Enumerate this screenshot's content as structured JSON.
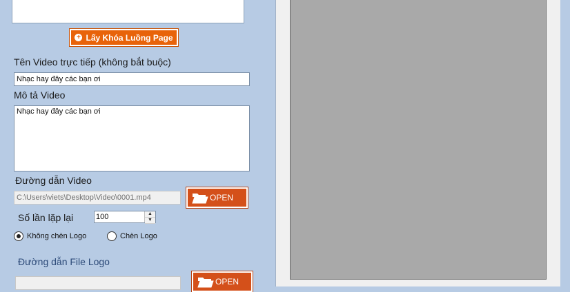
{
  "page_key_button": {
    "label": "Lấy Khóa Luồng Page",
    "icon": "plus-circle-icon"
  },
  "live_video_name": {
    "label": "Tên Video trực tiếp (không bắt buộc)",
    "value": "Nhạc hay đây các bạn ơi"
  },
  "video_description": {
    "label": "Mô tả Video",
    "value": "Nhạc hay đây các bạn ơi"
  },
  "video_path": {
    "label": "Đường dẫn Video",
    "value": "C:\\Users\\viets\\Desktop\\Video\\0001.mp4",
    "open_label": "OPEN"
  },
  "repeat_count": {
    "label": "Số lần lặp lại",
    "value": "100"
  },
  "logo_options": {
    "no_logo": "Không chèn Logo",
    "insert_logo": "Chèn Logo",
    "selected": "no_logo"
  },
  "logo_path": {
    "label": "Đường dẫn File Logo",
    "value": "",
    "open_label": "OPEN"
  },
  "colors": {
    "background": "#b7cbe4",
    "accent": "#e8630a",
    "open_button": "#d4501a",
    "preview": "#a9a9a9"
  }
}
